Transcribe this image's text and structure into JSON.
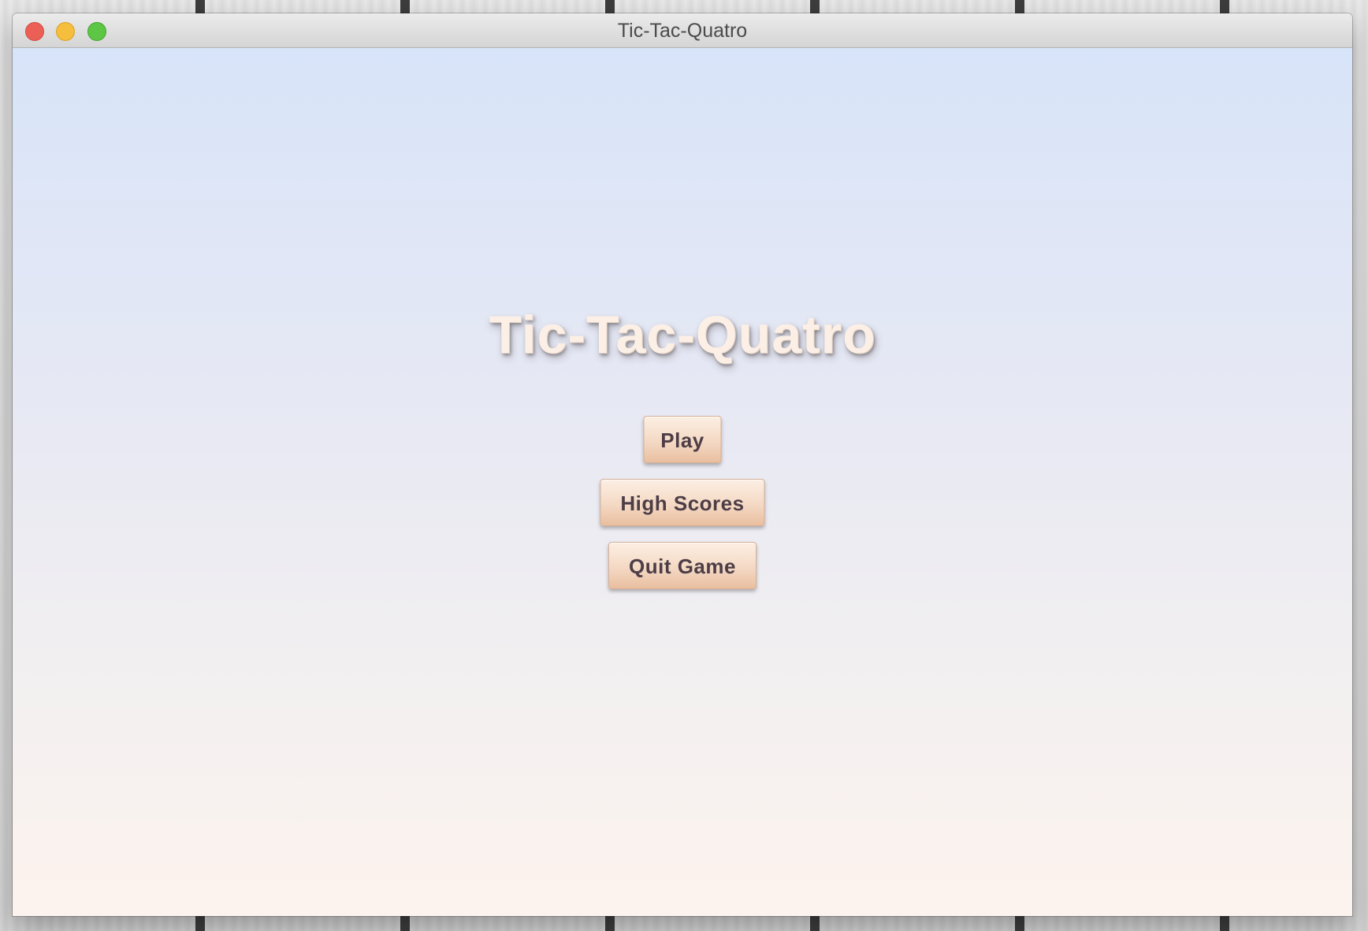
{
  "window": {
    "title": "Tic-Tac-Quatro"
  },
  "game": {
    "title": "Tic-Tac-Quatro"
  },
  "menu": {
    "play_label": "Play",
    "high_scores_label": "High Scores",
    "quit_label": "Quit Game"
  },
  "colors": {
    "button_text": "#4d3d46",
    "title_text": "#fbefe6",
    "traffic_close": "#ec5f57",
    "traffic_minimize": "#f5be3c",
    "traffic_zoom": "#5dc645"
  }
}
